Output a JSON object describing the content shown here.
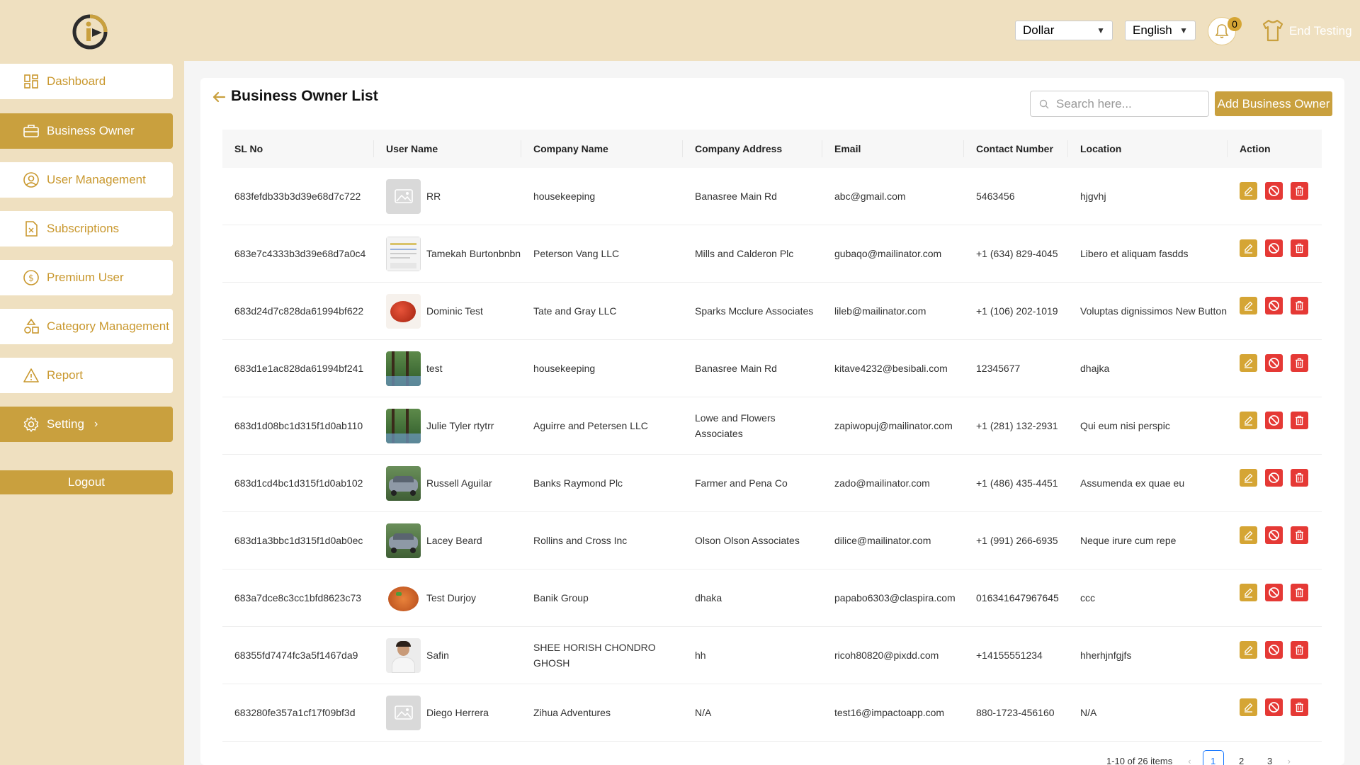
{
  "header": {
    "currency_select": "Dollar",
    "language_select": "English",
    "notification_count": "0",
    "end_testing_label": "End Testing"
  },
  "sidebar": {
    "items": [
      {
        "label": "Dashboard",
        "icon": "dashboard-icon",
        "active": false
      },
      {
        "label": "Business Owner",
        "icon": "briefcase-icon",
        "active": true
      },
      {
        "label": "User Management",
        "icon": "user-circle-icon",
        "active": false
      },
      {
        "label": "Subscriptions",
        "icon": "document-icon",
        "active": false
      },
      {
        "label": "Premium User",
        "icon": "dollar-coin-icon",
        "active": false
      },
      {
        "label": "Category Management",
        "icon": "shapes-icon",
        "active": false
      },
      {
        "label": "Report",
        "icon": "warning-icon",
        "active": false
      },
      {
        "label": "Setting",
        "icon": "gear-icon",
        "active": true
      }
    ],
    "logout_label": "Logout"
  },
  "main": {
    "title": "Business Owner List",
    "search_placeholder": "Search here...",
    "add_button_label": "Add Business Owner",
    "table": {
      "columns": [
        "SL No",
        "User Name",
        "Company Name",
        "Company Address",
        "Email",
        "Contact Number",
        "Location",
        "Action"
      ],
      "rows": [
        {
          "sl": "683fefdb33b3d39e68d7c722",
          "user": "RR",
          "company": "housekeeping",
          "address": "Banasree Main Rd",
          "email": "abc@gmail.com",
          "contact": "5463456",
          "location": "hjgvhj",
          "avatar": "placeholder"
        },
        {
          "sl": "683e7c4333b3d39e68d7a0c4",
          "user": "Tamekah Burtonbnbn",
          "company": "Peterson Vang LLC",
          "address": "Mills and Calderon Plc",
          "email": "gubaqo@mailinator.com",
          "contact": "+1 (634) 829-4045",
          "location": "Libero et aliquam fasdds",
          "avatar": "document"
        },
        {
          "sl": "683d24d7c828da61994bf622",
          "user": "Dominic Test",
          "company": "Tate and Gray LLC",
          "address": "Sparks Mcclure Associates",
          "email": "lileb@mailinator.com",
          "contact": "+1 (106) 202-1019",
          "location": "Voluptas dignissimos New Button",
          "avatar": "food-red"
        },
        {
          "sl": "683d1e1ac828da61994bf241",
          "user": "test",
          "company": "housekeeping",
          "address": "Banasree Main Rd",
          "email": "kitave4232@besibali.com",
          "contact": "12345677",
          "location": "dhajka",
          "avatar": "forest"
        },
        {
          "sl": "683d1d08bc1d315f1d0ab110",
          "user": "Julie Tyler rtytrr",
          "company": "Aguirre and Petersen LLC",
          "address": "Lowe and Flowers Associates",
          "email": "zapiwopuj@mailinator.com",
          "contact": "+1 (281) 132-2931",
          "location": "Qui eum nisi perspic",
          "avatar": "forest"
        },
        {
          "sl": "683d1cd4bc1d315f1d0ab102",
          "user": "Russell Aguilar",
          "company": "Banks Raymond Plc",
          "address": "Farmer and Pena Co",
          "email": "zado@mailinator.com",
          "contact": "+1 (486) 435-4451",
          "location": "Assumenda ex quae eu",
          "avatar": "car"
        },
        {
          "sl": "683d1a3bbc1d315f1d0ab0ec",
          "user": "Lacey Beard",
          "company": "Rollins and Cross Inc",
          "address": "Olson Olson Associates",
          "email": "dilice@mailinator.com",
          "contact": "+1 (991) 266-6935",
          "location": "Neque irure cum repe",
          "avatar": "car"
        },
        {
          "sl": "683a7dce8c3cc1bfd8623c73",
          "user": "Test Durjoy",
          "company": "Banik Group",
          "address": "dhaka",
          "email": "papabo6303@claspira.com",
          "contact": "016341647967645",
          "location": "ccc",
          "avatar": "food-plate"
        },
        {
          "sl": "68355fd7474fc3a5f1467da9",
          "user": "Safin",
          "company": "SHEE HORISH CHONDRO GHOSH",
          "address": "hh",
          "email": "ricoh80820@pixdd.com",
          "contact": "+14155551234",
          "location": "hherhjnfgjfs",
          "avatar": "person"
        },
        {
          "sl": "683280fe357a1cf17f09bf3d",
          "user": "Diego Herrera",
          "company": "Zihua Adventures",
          "address": "N/A",
          "email": "test16@impactoapp.com",
          "contact": "880-1723-456160",
          "location": "N/A",
          "avatar": "placeholder"
        }
      ]
    },
    "pagination": {
      "total_label": "1-10 of 26 items",
      "pages": [
        "1",
        "2",
        "3"
      ],
      "current": "1"
    }
  },
  "colors": {
    "accent": "#c9a03e",
    "background": "#efe0c0",
    "danger": "#e53935",
    "edit": "#d5a534"
  }
}
